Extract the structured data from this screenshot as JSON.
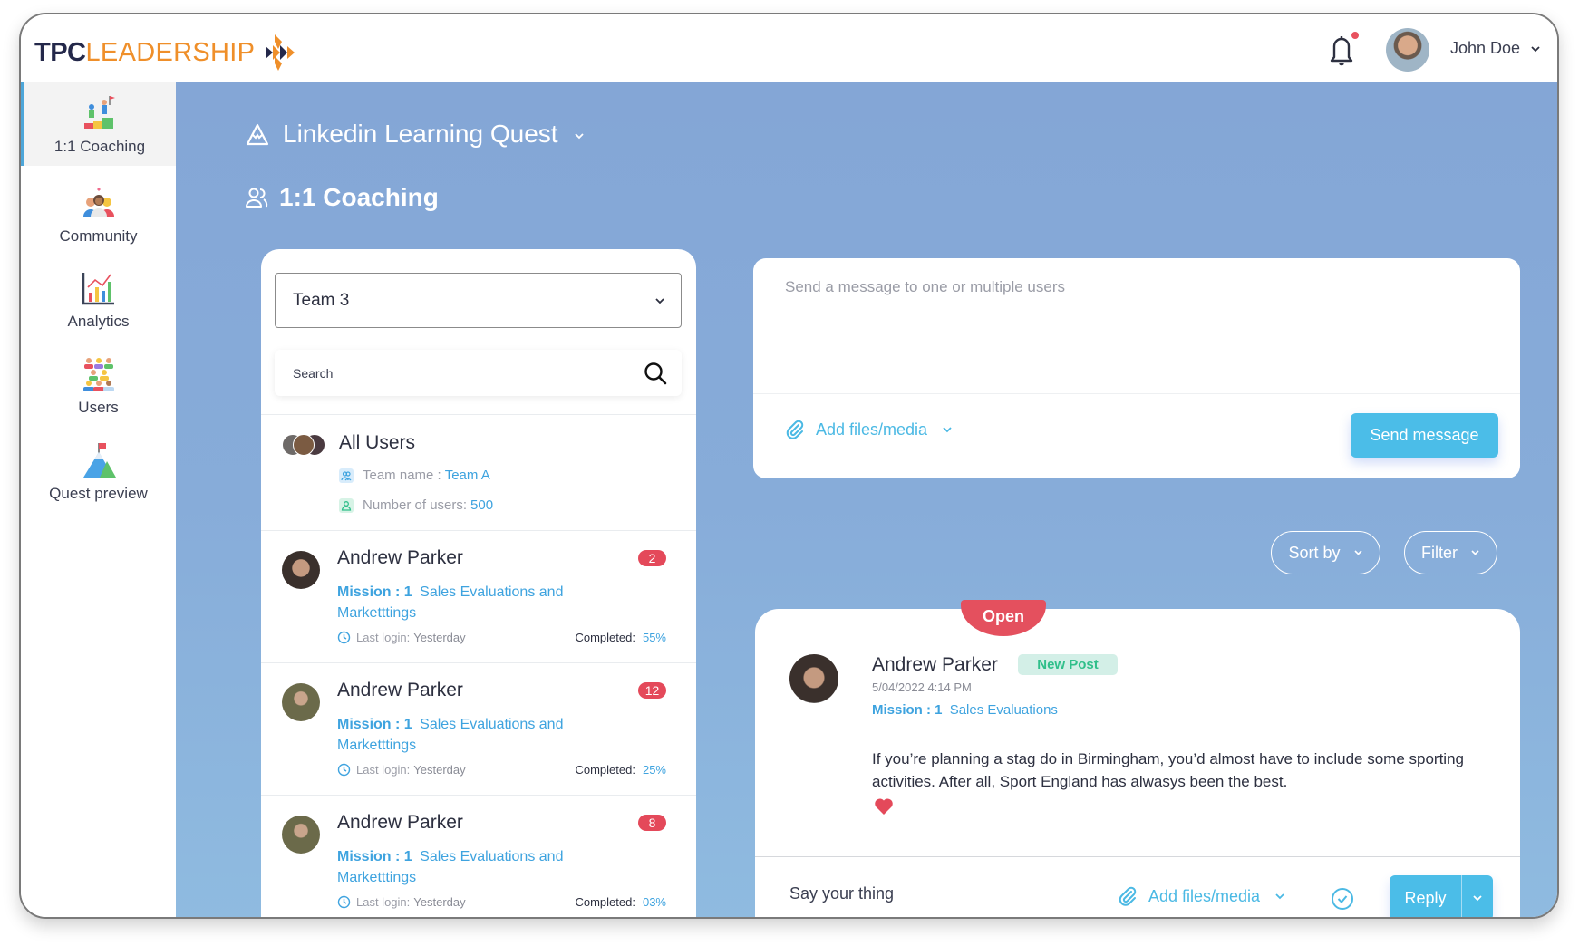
{
  "header": {
    "logo_primary": "TPC",
    "logo_secondary": "LEADERSHIP",
    "user_name": "John Doe",
    "notifications_unread": true
  },
  "sidebar": {
    "active": "1:1 Coaching",
    "items": [
      {
        "label": "1:1 Coaching",
        "icon": "coaching-icon"
      },
      {
        "label": "Community",
        "icon": "community-icon"
      },
      {
        "label": "Analytics",
        "icon": "analytics-icon"
      },
      {
        "label": "Users",
        "icon": "users-icon"
      },
      {
        "label": "Quest preview",
        "icon": "quest-preview-icon"
      }
    ]
  },
  "main": {
    "quest_title": "Linkedin Learning Quest",
    "section_title": "1:1 Coaching"
  },
  "list": {
    "team_select": "Team 3",
    "search_placeholder": "Search",
    "all_users": {
      "name": "All Users",
      "team_label": "Team name :",
      "team_value": "Team A",
      "count_label": "Number of users:",
      "count_value": "500"
    },
    "users": [
      {
        "name": "Andrew Parker",
        "badge": "2",
        "mission_label": "Mission : 1",
        "mission_title": "Sales Evaluations and Marketttings",
        "login_label": "Last login:",
        "login_value": "Yesterday",
        "completed_label": "Completed:",
        "completed_value": "55%"
      },
      {
        "name": "Andrew Parker",
        "badge": "12",
        "mission_label": "Mission : 1",
        "mission_title": "Sales Evaluations and Marketttings",
        "login_label": "Last login:",
        "login_value": "Yesterday",
        "completed_label": "Completed:",
        "completed_value": "25%"
      },
      {
        "name": "Andrew Parker",
        "badge": "8",
        "mission_label": "Mission : 1",
        "mission_title": "Sales Evaluations and Marketttings",
        "login_label": "Last login:",
        "login_value": "Yesterday",
        "completed_label": "Completed:",
        "completed_value": "03%"
      }
    ]
  },
  "composer": {
    "placeholder": "Send a message to one or multiple users",
    "attach_label": "Add files/media",
    "send_label": "Send message"
  },
  "filters": {
    "sort_label": "Sort by",
    "filter_label": "Filter"
  },
  "post": {
    "status": "Open",
    "author": "Andrew Parker",
    "badge": "New Post",
    "date": "5/04/2022  4:14 PM",
    "mission_label": "Mission : 1",
    "mission_title": "Sales Evaluations",
    "body": "If you’re planning a stag do in Birmingham, you’d almost have to include some sporting activities. After all, Sport England has alwasys been the best.",
    "reaction": "heart",
    "reply_placeholder": "Say your thing",
    "attach_label": "Add files/media",
    "reply_label": "Reply"
  },
  "colors": {
    "accent": "#4bbde8",
    "link": "#3ea3df",
    "badge_red": "#e4495a",
    "new_post_green": "#2fbf8a",
    "brand_orange": "#ef8f2a",
    "brand_navy": "#24284a",
    "background_blue": "#84a6d6"
  }
}
